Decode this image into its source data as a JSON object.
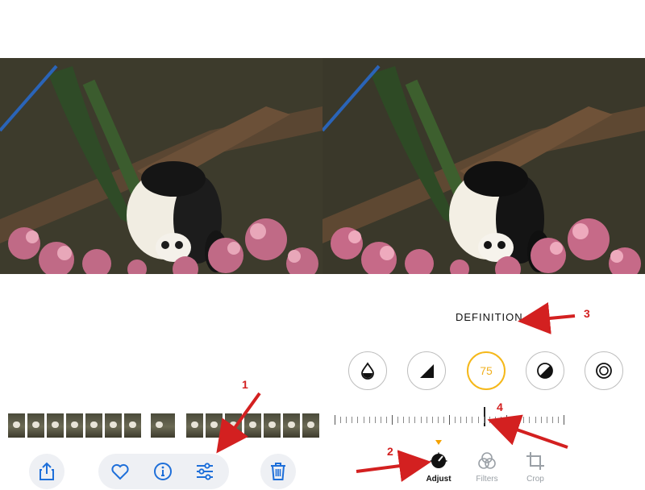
{
  "comparison": {
    "left_photo": {
      "description_icon": "panda-photo-icon"
    },
    "right_photo": {
      "description_icon": "panda-photo-icon"
    }
  },
  "library_view": {
    "filmstrip_count": 15,
    "toolbar": {
      "share_icon": "share-icon",
      "favorite_icon": "heart-icon",
      "info_icon": "info-icon",
      "edit_icon": "sliders-icon",
      "delete_icon": "trash-icon"
    }
  },
  "edit_view": {
    "adjustment_name": "DEFINITION",
    "adjustments": [
      {
        "icon": "vibrance-drop-icon"
      },
      {
        "icon": "contrast-triangle-icon"
      },
      {
        "icon": "definition-icon",
        "value": "75",
        "active": true
      },
      {
        "icon": "black-point-icon"
      },
      {
        "icon": "vignette-icon"
      }
    ],
    "slider_level": 0.65,
    "tabs": [
      {
        "label": "Adjust",
        "icon": "adjust-dial-icon",
        "active": true
      },
      {
        "label": "Filters",
        "icon": "filters-icon",
        "active": false
      },
      {
        "label": "Crop",
        "icon": "crop-icon",
        "active": false
      }
    ]
  },
  "annotations": {
    "step1": "1",
    "step2": "2",
    "step3": "3",
    "step4": "4",
    "color": "#d32020"
  }
}
